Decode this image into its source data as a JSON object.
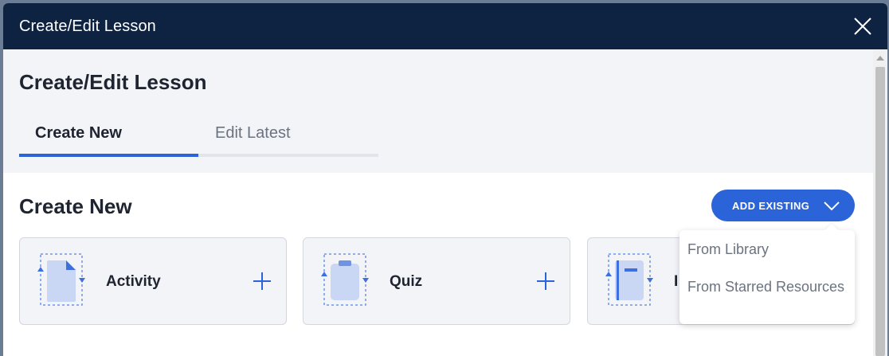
{
  "modal": {
    "title": "Create/Edit Lesson"
  },
  "page": {
    "title": "Create/Edit Lesson",
    "tabs": [
      {
        "label": "Create New",
        "active": true
      },
      {
        "label": "Edit Latest",
        "active": false
      }
    ]
  },
  "section": {
    "title": "Create New",
    "add_existing_label": "ADD EXISTING"
  },
  "cards": [
    {
      "label": "Activity",
      "icon": "document-icon"
    },
    {
      "label": "Quiz",
      "icon": "clipboard-icon"
    },
    {
      "label": "I",
      "icon": "notebook-icon"
    }
  ],
  "dropdown": {
    "items": [
      {
        "label": "From Library"
      },
      {
        "label": "From Starred Resources"
      }
    ]
  },
  "colors": {
    "header_bg": "#0e2342",
    "accent": "#2b63d9",
    "panel_bg": "#f3f4f8",
    "icon_fill": "#c9d6f4"
  }
}
